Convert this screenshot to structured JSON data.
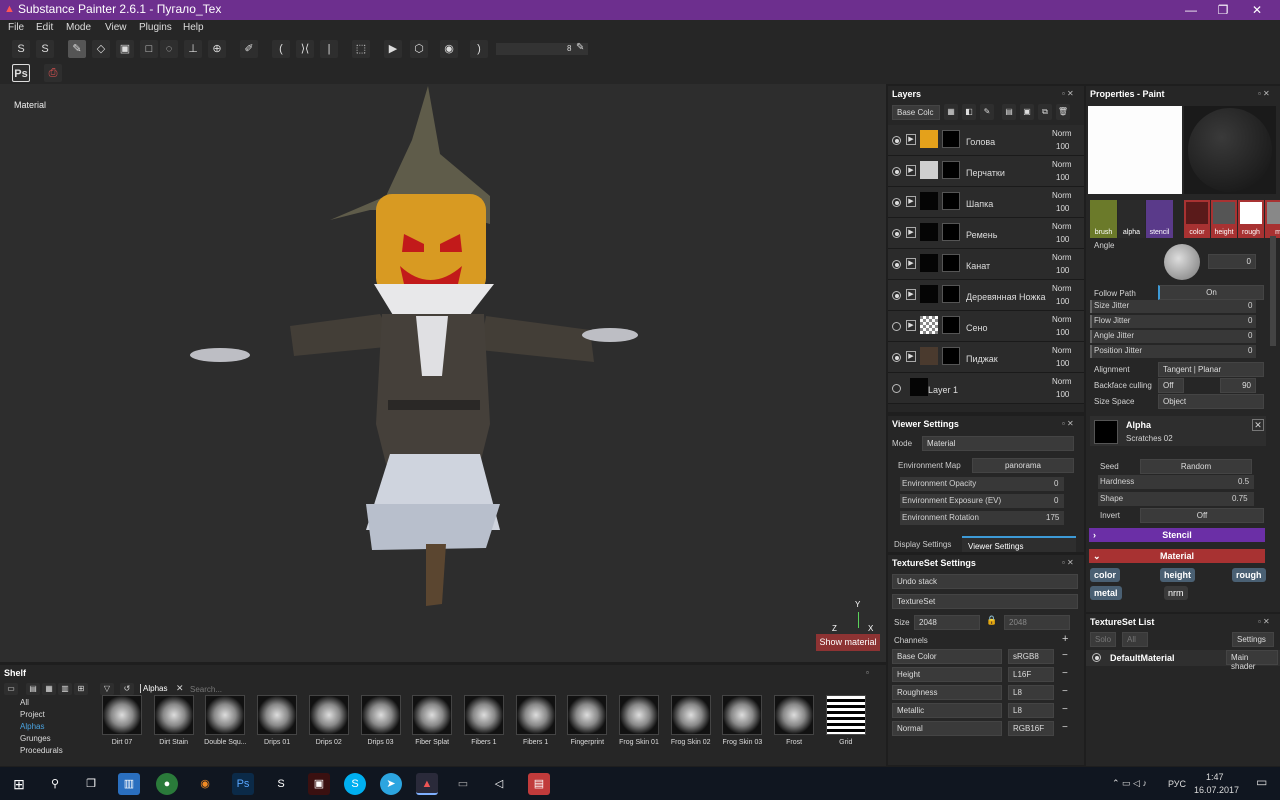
{
  "window": {
    "title": "Substance Painter 2.6.1 - Пугало_Tex"
  },
  "menu": [
    "File",
    "Edit",
    "Mode",
    "View",
    "Plugins",
    "Help"
  ],
  "toolbar": {
    "brush_size": "8"
  },
  "viewport": {
    "label": "Material",
    "show_material": "Show material",
    "axes": {
      "x": "X",
      "y": "Y",
      "z": "Z"
    }
  },
  "layers": {
    "title": "Layers",
    "channel_select": "Base Colc",
    "items": [
      {
        "name": "Голова",
        "blend": "Norm",
        "opacity": "100",
        "color": "#e4a11b",
        "visible": true
      },
      {
        "name": "Перчатки",
        "blend": "Norm",
        "opacity": "100",
        "color": "#cfcfcf",
        "visible": true
      },
      {
        "name": "Шапка",
        "blend": "Norm",
        "opacity": "100",
        "color": "#050505",
        "visible": true
      },
      {
        "name": "Ремень",
        "blend": "Norm",
        "opacity": "100",
        "color": "#050505",
        "visible": true
      },
      {
        "name": "Канат",
        "blend": "Norm",
        "opacity": "100",
        "color": "#050505",
        "visible": true
      },
      {
        "name": "Деревянная Ножка",
        "blend": "Norm",
        "opacity": "100",
        "color": "#050505",
        "visible": true
      },
      {
        "name": "Сено",
        "blend": "Norm",
        "opacity": "100",
        "color": "checker",
        "visible": false
      },
      {
        "name": "Пиджак",
        "blend": "Norm",
        "opacity": "100",
        "color": "#4a3a2e",
        "visible": true
      },
      {
        "name": "Layer 1",
        "blend": "Norm",
        "opacity": "100",
        "color": "#050505",
        "visible": false
      }
    ]
  },
  "viewer_settings": {
    "title": "Viewer Settings",
    "mode_label": "Mode",
    "mode_value": "Material",
    "env_map_label": "Environment Map",
    "env_map_value": "panorama",
    "env_opacity_label": "Environment Opacity",
    "env_opacity": "0",
    "env_exposure_label": "Environment Exposure (EV)",
    "env_exposure": "0",
    "env_rotation_label": "Environment Rotation",
    "env_rotation": "175",
    "tabs": [
      "Display Settings",
      "Viewer Settings"
    ]
  },
  "textureset_settings": {
    "title": "TextureSet Settings",
    "undo_stack": "Undo stack",
    "textureset": "TextureSet",
    "size_label": "Size",
    "size_value": "2048",
    "size_value2": "2048",
    "channels_label": "Channels",
    "channels": [
      {
        "name": "Base Color",
        "format": "sRGB8"
      },
      {
        "name": "Height",
        "format": "L16F"
      },
      {
        "name": "Roughness",
        "format": "L8"
      },
      {
        "name": "Metallic",
        "format": "L8"
      },
      {
        "name": "Normal",
        "format": "RGB16F"
      }
    ]
  },
  "properties": {
    "title": "Properties - Paint",
    "brush_tabs": [
      "brush",
      "alpha",
      "stencil"
    ],
    "mat_tabs": [
      "color",
      "height",
      "rough",
      "m"
    ],
    "angle_label": "Angle",
    "angle_value": "0",
    "follow_path_label": "Follow Path",
    "follow_path_value": "On",
    "jitters": [
      {
        "label": "Size Jitter",
        "value": "0"
      },
      {
        "label": "Flow Jitter",
        "value": "0"
      },
      {
        "label": "Angle Jitter",
        "value": "0"
      },
      {
        "label": "Position Jitter",
        "value": "0"
      }
    ],
    "alignment_label": "Alignment",
    "alignment_value": "Tangent | Planar",
    "backface_label": "Backface culling",
    "backface_value": "Off",
    "backface_num": "90",
    "sizespace_label": "Size Space",
    "sizespace_value": "Object",
    "alpha_title": "Alpha",
    "alpha_name": "Scratches 02",
    "seed_label": "Seed",
    "seed_value": "Random",
    "hardness_label": "Hardness",
    "hardness_value": "0.5",
    "shape_label": "Shape",
    "shape_value": "0.75",
    "invert_label": "Invert",
    "invert_value": "Off",
    "stencil_label": "Stencil",
    "material_label": "Material",
    "mat_buttons": [
      "color",
      "height",
      "rough",
      "metal",
      "nrm"
    ],
    "colors": {
      "stencil": "#6b2fa6",
      "material": "#a83232"
    }
  },
  "textureset_list": {
    "title": "TextureSet List",
    "solo": "Solo",
    "all": "All",
    "settings": "Settings",
    "item_name": "DefaultMaterial",
    "item_shader": "Main shader"
  },
  "shelf": {
    "title": "Shelf",
    "filter_tag": "Alphas",
    "search_placeholder": "Search...",
    "categories": [
      "All",
      "Project",
      "Alphas",
      "Grunges",
      "Procedurals"
    ],
    "items": [
      "Dirt 07",
      "Dirt Stain",
      "Double Squ...",
      "Drips 01",
      "Drips 02",
      "Drips 03",
      "Fiber Splat",
      "Fibers 1",
      "Fibers 1",
      "Fingerprint",
      "Frog Skin 01",
      "Frog Skin 02",
      "Frog Skin 03",
      "Frost",
      "Grid"
    ]
  },
  "taskbar": {
    "lang": "РУС",
    "time": "1:47",
    "date": "16.07.2017"
  }
}
